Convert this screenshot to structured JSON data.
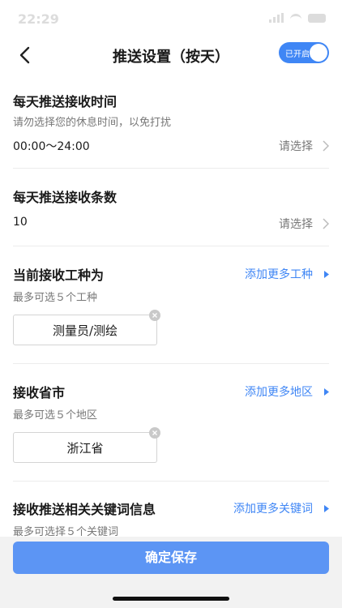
{
  "status_bar": {
    "time": "22:29"
  },
  "header": {
    "title": "推送设置（按天）",
    "toggle_label": "已开启"
  },
  "sections": {
    "time": {
      "title": "每天推送接收时间",
      "subtitle": "请勿选择您的休息时间，以免打扰",
      "value": "00:00～24:00",
      "action": "请选择"
    },
    "count": {
      "title": "每天推送接收条数",
      "value": "10",
      "action": "请选择"
    },
    "worktype": {
      "title": "当前接收工种为",
      "subtitle": "最多可选５个工种",
      "action": "添加更多工种",
      "tags": [
        "测量员/测绘"
      ]
    },
    "region": {
      "title": "接收省市",
      "subtitle": "最多可选５个地区",
      "action": "添加更多地区",
      "tags": [
        "浙江省"
      ]
    },
    "keywords": {
      "title": "接收推送相关关键词信息",
      "subtitle": "最多可选择５个关键词",
      "action": "添加更多关键词"
    }
  },
  "footer": {
    "save_label": "确定保存"
  },
  "colors": {
    "accent": "#3f86f5",
    "save_button": "#5c95f4",
    "background": "#f2f2f2"
  }
}
